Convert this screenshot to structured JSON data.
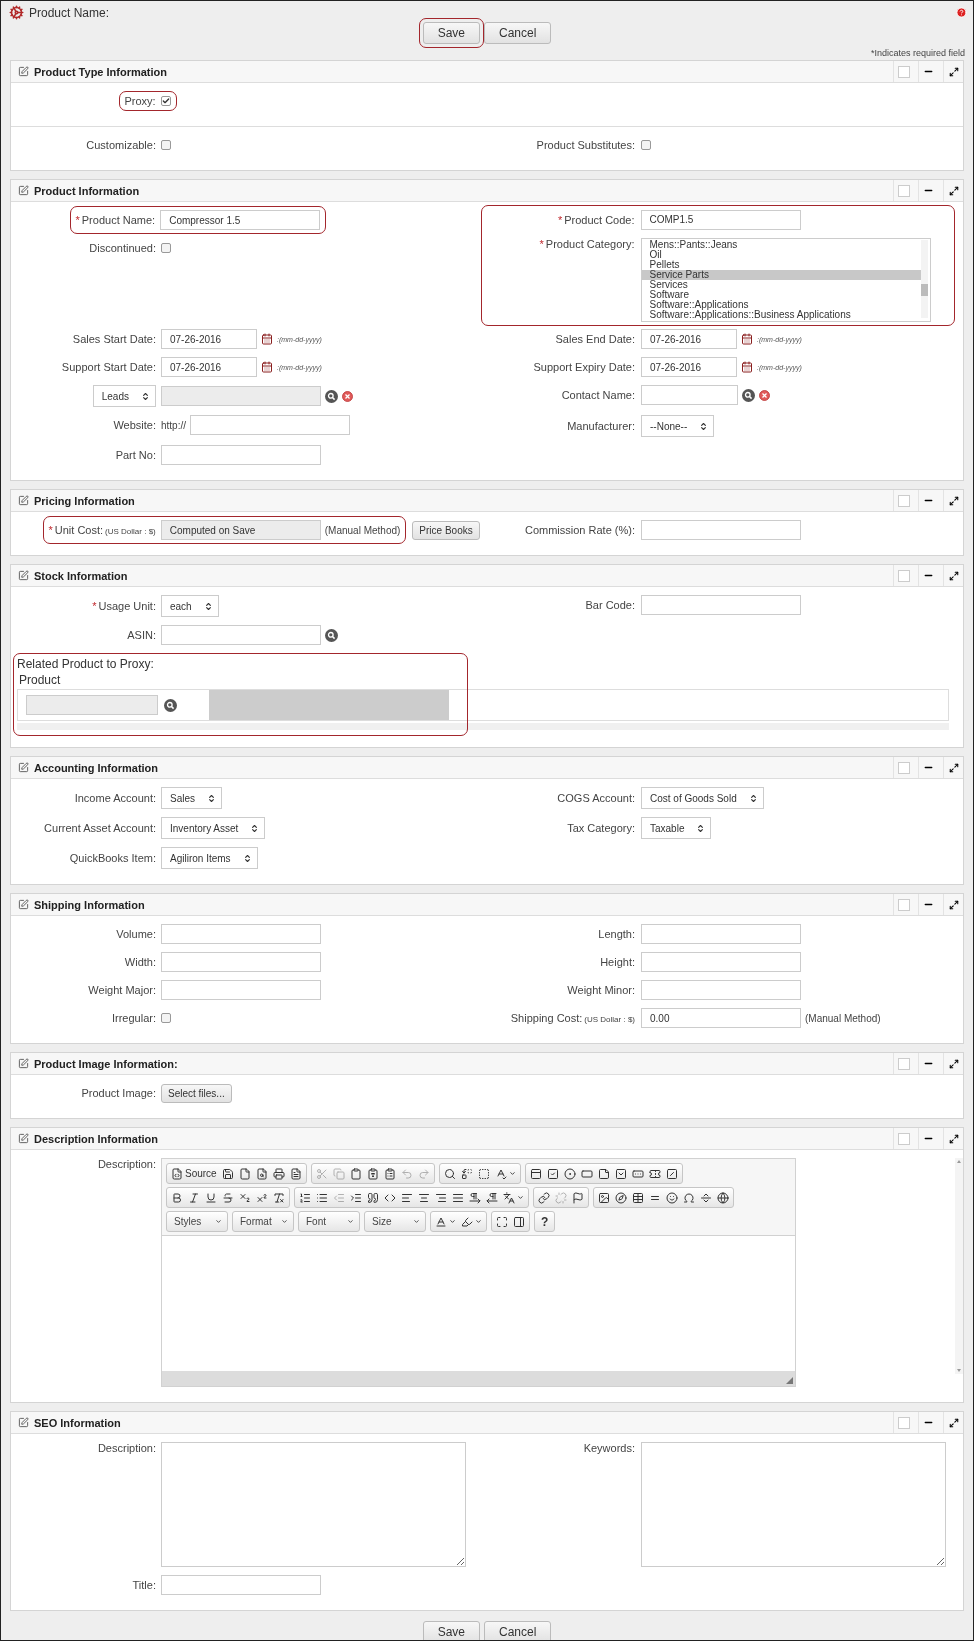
{
  "page": {
    "title": "Product Name:",
    "required_note": "*Indicates required field"
  },
  "top_actions": [
    {
      "label": "Save",
      "highlighted": true
    },
    {
      "label": "Cancel"
    }
  ],
  "sections": [
    {
      "title": "Product Type Information",
      "blocks": [
        [
          {
            "kind": "pair",
            "left": {
              "fields": [
                {
                  "kind": "checkbox",
                  "label": "Proxy:",
                  "checked": true,
                  "highlighted": true
                }
              ]
            }
          }
        ],
        [
          {
            "kind": "pair",
            "left": {
              "fields": [
                {
                  "kind": "checkbox",
                  "label": "Customizable:",
                  "checked": false
                }
              ]
            },
            "right": {
              "fields": [
                {
                  "kind": "checkbox",
                  "label": "Product Substitutes:",
                  "checked": false
                }
              ]
            }
          }
        ]
      ]
    },
    {
      "title": "Product Information",
      "blocks": [
        [
          {
            "kind": "pair",
            "left": {
              "fields": [
                {
                  "kind": "text",
                  "required_mark": "*",
                  "label": "Product Name:",
                  "value": "Compressor 1.5",
                  "highlighted": true
                },
                {
                  "kind": "checkbox",
                  "label": "Discontinued:",
                  "checked": false
                }
              ]
            },
            "right": {
              "highlighted": true,
              "fields": [
                {
                  "kind": "text",
                  "required_mark": "*",
                  "label": "Product Code:",
                  "value": "COMP1.5"
                },
                {
                  "kind": "listbox",
                  "required_mark": "*",
                  "label": "Product Category:",
                  "options": [
                    {
                      "label": "Mens::Pants::Jeans",
                      "selected": false
                    },
                    {
                      "label": "Oil",
                      "selected": false
                    },
                    {
                      "label": "Pellets",
                      "selected": false
                    },
                    {
                      "label": "Service Parts",
                      "selected": true
                    },
                    {
                      "label": "Services",
                      "selected": false
                    },
                    {
                      "label": "Software",
                      "selected": false
                    },
                    {
                      "label": "Software::Applications",
                      "selected": false
                    },
                    {
                      "label": "Software::Applications::Business Applications",
                      "selected": false
                    }
                  ]
                }
              ]
            }
          },
          {
            "kind": "pair",
            "left": {
              "fields": [
                {
                  "kind": "date",
                  "label": "Sales Start Date:",
                  "value": "07-26-2016",
                  "hint": ":(mm-dd-yyyy)"
                }
              ]
            },
            "right": {
              "fields": [
                {
                  "kind": "date",
                  "label": "Sales End Date:",
                  "value": "07-26-2016",
                  "hint": ":(mm-dd-yyyy)"
                }
              ]
            }
          },
          {
            "kind": "pair",
            "left": {
              "fields": [
                {
                  "kind": "date",
                  "label": "Support Start Date:",
                  "value": "07-26-2016",
                  "hint": ":(mm-dd-yyyy)"
                }
              ]
            },
            "right": {
              "fields": [
                {
                  "kind": "date",
                  "label": "Support Expiry Date:",
                  "value": "07-26-2016",
                  "hint": ":(mm-dd-yyyy)"
                }
              ]
            }
          },
          {
            "kind": "pair",
            "left": {
              "fields": [
                {
                  "kind": "lookup",
                  "selector": "Leads",
                  "disabled": true,
                  "search": true,
                  "clear": true
                }
              ]
            },
            "right": {
              "fields": [
                {
                  "kind": "text",
                  "label": "Contact Name:",
                  "search": true,
                  "clear": true,
                  "short": true
                }
              ]
            }
          },
          {
            "kind": "pair",
            "left": {
              "fields": [
                {
                  "kind": "text",
                  "label": "Website:",
                  "prefix": "http://"
                }
              ]
            },
            "right": {
              "fields": [
                {
                  "kind": "select",
                  "label": "Manufacturer:",
                  "value": "--None--"
                }
              ]
            }
          },
          {
            "kind": "pair",
            "left": {
              "fields": [
                {
                  "kind": "text",
                  "label": "Part No:"
                }
              ]
            }
          }
        ]
      ]
    },
    {
      "title": "Pricing Information",
      "blocks": [
        [
          {
            "kind": "pair",
            "left": {
              "fields": [
                {
                  "kind": "text",
                  "required_mark": "*",
                  "label": "Unit Cost:",
                  "unit": "(US Dollar : $)",
                  "value": "Computed on Save",
                  "disabled": true,
                  "suffix": "(Manual Method)",
                  "button": "Price Books",
                  "highlighted": true
                }
              ]
            },
            "right": {
              "fields": [
                {
                  "kind": "text",
                  "label": "Commission Rate (%):"
                }
              ]
            }
          }
        ]
      ]
    },
    {
      "title": "Stock Information",
      "blocks": [
        [
          {
            "kind": "pair",
            "left": {
              "fields": [
                {
                  "kind": "select",
                  "required_mark": "*",
                  "label": "Usage Unit:",
                  "value": "each"
                }
              ]
            },
            "right": {
              "fields": [
                {
                  "kind": "text",
                  "label": "Bar Code:"
                }
              ]
            }
          },
          {
            "kind": "pair",
            "left": {
              "fields": [
                {
                  "kind": "text",
                  "label": "ASIN:",
                  "search": true
                }
              ]
            }
          },
          {
            "kind": "related",
            "title": "Related Product to Proxy:",
            "column": "Product",
            "highlighted": true
          }
        ]
      ]
    },
    {
      "title": "Accounting Information",
      "blocks": [
        [
          {
            "kind": "pair",
            "left": {
              "fields": [
                {
                  "kind": "select",
                  "label": "Income Account:",
                  "value": "Sales"
                }
              ]
            },
            "right": {
              "fields": [
                {
                  "kind": "select",
                  "label": "COGS Account:",
                  "value": "Cost of Goods Sold"
                }
              ]
            }
          },
          {
            "kind": "pair",
            "left": {
              "fields": [
                {
                  "kind": "select",
                  "label": "Current Asset Account:",
                  "value": "Inventory Asset"
                }
              ]
            },
            "right": {
              "fields": [
                {
                  "kind": "select",
                  "label": "Tax Category:",
                  "value": "Taxable"
                }
              ]
            }
          },
          {
            "kind": "pair",
            "left": {
              "fields": [
                {
                  "kind": "select",
                  "label": "QuickBooks Item:",
                  "value": "Agiliron Items"
                }
              ]
            }
          }
        ]
      ]
    },
    {
      "title": "Shipping Information",
      "blocks": [
        [
          {
            "kind": "pair",
            "left": {
              "fields": [
                {
                  "kind": "text",
                  "label": "Volume:"
                }
              ]
            },
            "right": {
              "fields": [
                {
                  "kind": "text",
                  "label": "Length:"
                }
              ]
            }
          },
          {
            "kind": "pair",
            "left": {
              "fields": [
                {
                  "kind": "text",
                  "label": "Width:"
                }
              ]
            },
            "right": {
              "fields": [
                {
                  "kind": "text",
                  "label": "Height:"
                }
              ]
            }
          },
          {
            "kind": "pair",
            "left": {
              "fields": [
                {
                  "kind": "text",
                  "label": "Weight Major:"
                }
              ]
            },
            "right": {
              "fields": [
                {
                  "kind": "text",
                  "label": "Weight Minor:"
                }
              ]
            }
          },
          {
            "kind": "pair",
            "left": {
              "fields": [
                {
                  "kind": "checkbox",
                  "label": "Irregular:",
                  "checked": false
                }
              ]
            },
            "right": {
              "fields": [
                {
                  "kind": "text",
                  "label": "Shipping Cost:",
                  "unit": "(US Dollar : $)",
                  "value": "0.00",
                  "suffix": "(Manual Method)"
                }
              ]
            }
          }
        ]
      ]
    },
    {
      "title": "Product Image Information:",
      "blocks": [
        [
          {
            "kind": "pair",
            "left": {
              "fields": [
                {
                  "kind": "file",
                  "label": "Product Image:",
                  "button": "Select files..."
                }
              ]
            }
          }
        ]
      ]
    },
    {
      "title": "Description Information",
      "blocks": [
        [
          {
            "kind": "wide",
            "label": "Description:",
            "toolbar": [
              [
                [
                  {
                    "kind": "labeled",
                    "label": "Source"
                  },
                  {
                    "kind": "icon",
                    "disabled": false
                  },
                  {
                    "kind": "icon",
                    "disabled": false
                  },
                  {
                    "kind": "icon",
                    "disabled": false
                  },
                  {
                    "kind": "icon",
                    "disabled": false
                  },
                  {
                    "kind": "icon",
                    "disabled": false
                  }
                ],
                [
                  {
                    "kind": "icon",
                    "disabled": true
                  },
                  {
                    "kind": "icon",
                    "disabled": true
                  },
                  {
                    "kind": "icon",
                    "disabled": false
                  },
                  {
                    "kind": "icon",
                    "disabled": false
                  },
                  {
                    "kind": "icon",
                    "disabled": false
                  },
                  {
                    "kind": "icon",
                    "disabled": true
                  },
                  {
                    "kind": "icon",
                    "disabled": true
                  }
                ],
                [
                  {
                    "kind": "icon",
                    "disabled": false
                  },
                  {
                    "kind": "icon",
                    "disabled": false
                  },
                  {
                    "kind": "icon",
                    "disabled": false
                  },
                  {
                    "kind": "menu"
                  }
                ],
                [
                  {
                    "kind": "icon",
                    "disabled": false
                  },
                  {
                    "kind": "icon",
                    "disabled": false
                  },
                  {
                    "kind": "icon",
                    "disabled": false
                  },
                  {
                    "kind": "icon",
                    "disabled": false
                  },
                  {
                    "kind": "icon",
                    "disabled": false
                  },
                  {
                    "kind": "icon",
                    "disabled": false
                  },
                  {
                    "kind": "icon",
                    "disabled": false
                  },
                  {
                    "kind": "icon",
                    "disabled": false
                  },
                  {
                    "kind": "icon",
                    "disabled": false
                  }
                ]
              ],
              [
                [
                  {
                    "kind": "icon",
                    "disabled": false
                  },
                  {
                    "kind": "icon",
                    "disabled": false
                  },
                  {
                    "kind": "icon",
                    "disabled": false
                  },
                  {
                    "kind": "icon",
                    "disabled": false
                  },
                  {
                    "kind": "icon",
                    "disabled": false
                  },
                  {
                    "kind": "icon",
                    "disabled": false
                  },
                  {
                    "kind": "icon",
                    "disabled": false
                  }
                ],
                [
                  {
                    "kind": "icon",
                    "disabled": false
                  },
                  {
                    "kind": "icon",
                    "disabled": false
                  },
                  {
                    "kind": "icon",
                    "disabled": true
                  },
                  {
                    "kind": "icon",
                    "disabled": false
                  },
                  {
                    "kind": "icon",
                    "disabled": false
                  },
                  {
                    "kind": "icon",
                    "disabled": false
                  },
                  {
                    "kind": "icon",
                    "disabled": false
                  },
                  {
                    "kind": "icon",
                    "disabled": false
                  },
                  {
                    "kind": "icon",
                    "disabled": false
                  },
                  {
                    "kind": "icon",
                    "disabled": false
                  },
                  {
                    "kind": "icon",
                    "disabled": false
                  },
                  {
                    "kind": "icon",
                    "disabled": false
                  },
                  {
                    "kind": "menu"
                  }
                ],
                [
                  {
                    "kind": "icon",
                    "disabled": false
                  },
                  {
                    "kind": "icon",
                    "disabled": true
                  },
                  {
                    "kind": "icon",
                    "disabled": false
                  }
                ],
                [
                  {
                    "kind": "icon",
                    "disabled": false
                  },
                  {
                    "kind": "icon",
                    "disabled": false
                  },
                  {
                    "kind": "icon",
                    "disabled": false
                  },
                  {
                    "kind": "icon",
                    "disabled": false
                  },
                  {
                    "kind": "icon",
                    "disabled": false
                  },
                  {
                    "kind": "icon",
                    "disabled": false
                  },
                  {
                    "kind": "icon",
                    "disabled": false
                  },
                  {
                    "kind": "icon",
                    "disabled": false
                  }
                ]
              ],
              [
                [
                  {
                    "kind": "dropdown",
                    "label": "Styles"
                  }
                ],
                [
                  {
                    "kind": "dropdown",
                    "label": "Format"
                  }
                ],
                [
                  {
                    "kind": "dropdown",
                    "label": "Font"
                  }
                ],
                [
                  {
                    "kind": "dropdown",
                    "label": "Size"
                  }
                ],
                [
                  {
                    "kind": "menu"
                  },
                  {
                    "kind": "menu"
                  }
                ],
                [
                  {
                    "kind": "icon",
                    "disabled": false
                  },
                  {
                    "kind": "icon",
                    "disabled": false
                  }
                ],
                [
                  {
                    "kind": "text",
                    "label": "?"
                  }
                ]
              ]
            ]
          }
        ]
      ]
    },
    {
      "title": "SEO Information",
      "blocks": [
        [
          {
            "kind": "pair",
            "left": {
              "fields": [
                {
                  "kind": "textarea",
                  "label": "Description:"
                }
              ]
            },
            "right": {
              "fields": [
                {
                  "kind": "textarea",
                  "label": "Keywords:"
                }
              ]
            }
          },
          {
            "kind": "pair",
            "left": {
              "fields": [
                {
                  "kind": "text",
                  "label": "Title:"
                }
              ]
            }
          }
        ]
      ]
    }
  ],
  "bottom_actions": [
    {
      "label": "Save"
    },
    {
      "label": "Cancel"
    }
  ]
}
